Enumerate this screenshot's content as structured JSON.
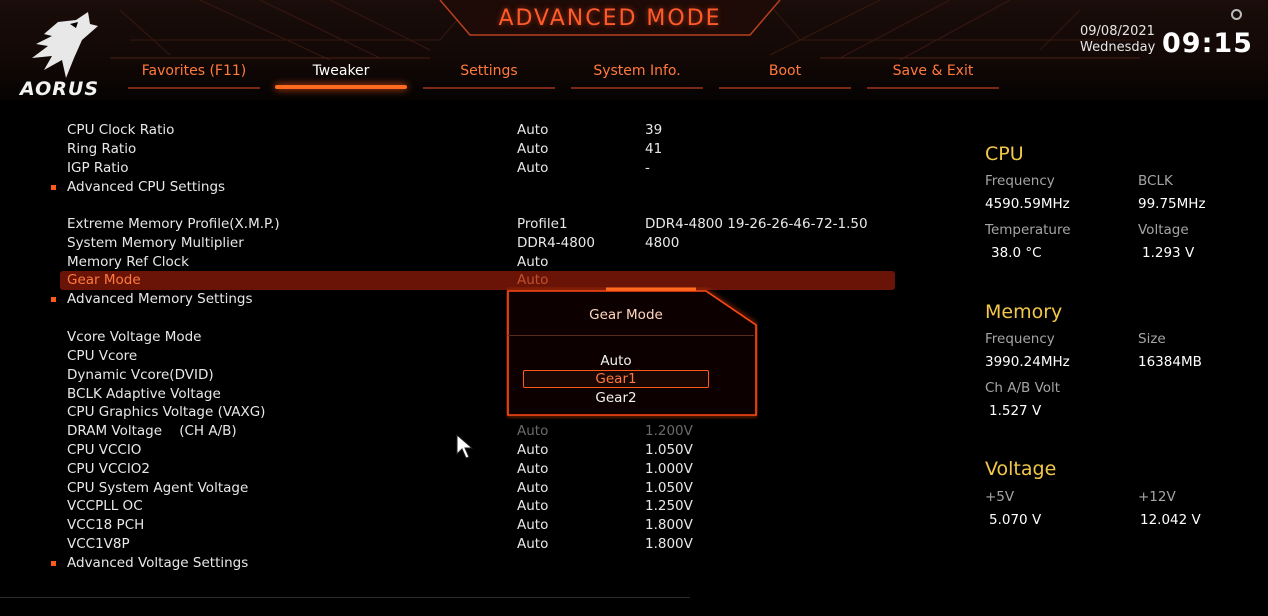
{
  "header": {
    "brand": "AORUS",
    "title": "ADVANCED MODE",
    "date": "09/08/2021",
    "weekday": "Wednesday",
    "time": "09:15",
    "tabs": [
      {
        "label": "Favorites (F11)",
        "active": false
      },
      {
        "label": "Tweaker",
        "active": true
      },
      {
        "label": "Settings",
        "active": false
      },
      {
        "label": "System Info.",
        "active": false
      },
      {
        "label": "Boot",
        "active": false
      },
      {
        "label": "Save & Exit",
        "active": false
      }
    ]
  },
  "settings": [
    {
      "name": "CPU Clock Ratio",
      "val1": "Auto",
      "val2": "39"
    },
    {
      "name": "Ring Ratio",
      "val1": "Auto",
      "val2": "41"
    },
    {
      "name": "IGP Ratio",
      "val1": "Auto",
      "val2": "-"
    },
    {
      "name": "Advanced CPU Settings",
      "val1": "",
      "val2": "",
      "submenu": true
    },
    {
      "name": "Extreme Memory Profile(X.M.P.)",
      "val1": "Profile1",
      "val2": "DDR4-4800 19-26-26-46-72-1.50"
    },
    {
      "name": "System Memory Multiplier",
      "val1": "DDR4-4800",
      "val2": "4800"
    },
    {
      "name": "Memory Ref Clock",
      "val1": "Auto",
      "val2": ""
    },
    {
      "name": "Gear Mode",
      "val1": "Auto",
      "val2": "",
      "selected": true
    },
    {
      "name": "Advanced Memory Settings",
      "val1": "",
      "val2": "",
      "submenu": true
    },
    {
      "name": "Vcore Voltage Mode",
      "val1": "",
      "val2": ""
    },
    {
      "name": "CPU Vcore",
      "val1": "",
      "val2": ""
    },
    {
      "name": "Dynamic Vcore(DVID)",
      "val1": "",
      "val2": ""
    },
    {
      "name": "BCLK Adaptive Voltage",
      "val1": "",
      "val2": ""
    },
    {
      "name": "CPU Graphics Voltage (VAXG)",
      "val1": "",
      "val2": ""
    },
    {
      "name": "DRAM Voltage    (CH A/B)",
      "val1": "Auto",
      "val2": "1.200V",
      "dim": true
    },
    {
      "name": "CPU VCCIO",
      "val1": "Auto",
      "val2": "1.050V"
    },
    {
      "name": "CPU VCCIO2",
      "val1": "Auto",
      "val2": "1.000V"
    },
    {
      "name": "CPU System Agent Voltage",
      "val1": "Auto",
      "val2": "1.050V"
    },
    {
      "name": "VCCPLL OC",
      "val1": "Auto",
      "val2": "1.250V"
    },
    {
      "name": "VCC18 PCH",
      "val1": "Auto",
      "val2": "1.800V"
    },
    {
      "name": "VCC1V8P",
      "val1": "Auto",
      "val2": "1.800V"
    },
    {
      "name": "Advanced Voltage Settings",
      "val1": "",
      "val2": "",
      "submenu": true
    }
  ],
  "popup": {
    "title": "Gear Mode",
    "options": [
      "Auto",
      "Gear1",
      "Gear2"
    ],
    "selected": "Gear1"
  },
  "panel": {
    "cpu": {
      "title": "CPU",
      "frequency_label": "Frequency",
      "frequency": "4590.59MHz",
      "bclk_label": "BCLK",
      "bclk": "99.75MHz",
      "temperature_label": "Temperature",
      "temperature": "38.0 °C",
      "voltage_label": "Voltage",
      "voltage": "1.293 V"
    },
    "memory": {
      "title": "Memory",
      "frequency_label": "Frequency",
      "frequency": "3990.24MHz",
      "size_label": "Size",
      "size": "16384MB",
      "chab_label": "Ch A/B Volt",
      "chab": "1.527 V"
    },
    "voltage": {
      "title": "Voltage",
      "p5v_label": "+5V",
      "p5v": "5.070 V",
      "p12v_label": "+12V",
      "p12v": "12.042 V"
    }
  },
  "colors": {
    "accent": "#ff5a1a",
    "highlight_row": "#6a1408",
    "panel_title": "#f2c84a"
  }
}
